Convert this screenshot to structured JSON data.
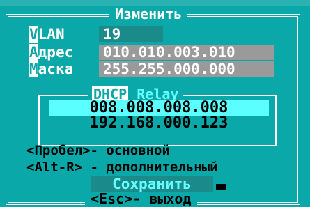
{
  "dialog": {
    "title": "Изменить",
    "vlan": {
      "label_first": "V",
      "label_rest": "LAN",
      "value": "19"
    },
    "address": {
      "label_first": "А",
      "label_rest": "дрес",
      "value": "010.010.003.010"
    },
    "mask": {
      "label_first": "М",
      "label_rest": "аска",
      "value": "255.255.000.000"
    },
    "dhcp": {
      "title_left": "DHCP",
      "title_right": "Relay",
      "servers": [
        "008.008.008.008",
        "192.168.000.123"
      ]
    },
    "hints": [
      "<Пробел>- основной",
      "<Alt-R> - дополнительный"
    ],
    "save_label": "Сохранить",
    "exit_label": "<Esc>- выход"
  },
  "colors": {
    "background": "#0aa8a8",
    "selection": "#5bffff",
    "field_dark": "#1a8a8a",
    "field_grey": "#9a9a9a"
  }
}
